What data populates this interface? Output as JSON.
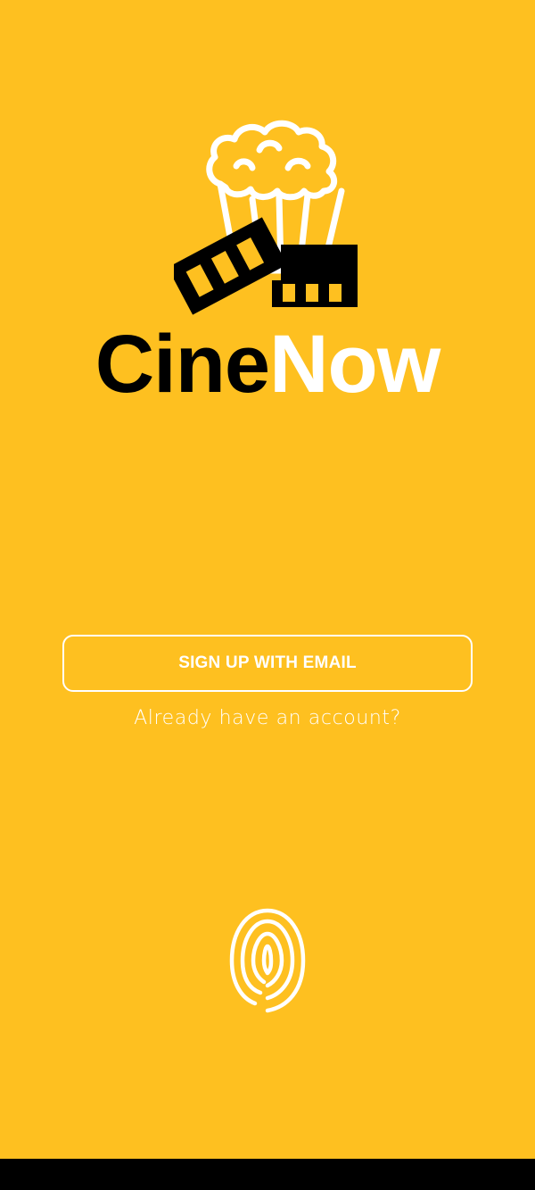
{
  "app": {
    "brand_part1": "Cine",
    "brand_part2": "Now",
    "brand_colors": {
      "background": "#FEC020",
      "primary_text": "#000000",
      "accent_text": "#FFFFFF"
    }
  },
  "actions": {
    "signup_label": "SIGN UP WITH EMAIL",
    "login_prompt": "Already have an account?"
  },
  "icons": {
    "logo": "popcorn-film-strip-icon",
    "fingerprint": "fingerprint-icon"
  }
}
